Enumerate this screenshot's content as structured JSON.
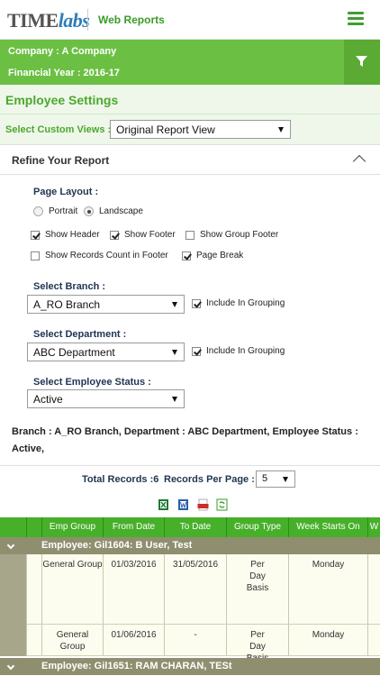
{
  "header": {
    "logo_text_1": "TIME",
    "logo_text_2": "labs",
    "title": "Web Reports",
    "menu_icon": "hamburger-icon"
  },
  "company": {
    "company_line": "Company : A Company",
    "year_line": "Financial Year : 2016-17",
    "filter_icon": "filter-icon"
  },
  "settings": {
    "title": "Employee Settings",
    "custom_views_label": "Select Custom Views :",
    "custom_views_value": "Original Report View"
  },
  "refine": {
    "title": "Refine Your Report",
    "page_layout_label": "Page Layout :",
    "portrait_label": "Portrait",
    "landscape_label": "Landscape",
    "layout_selected": "Landscape",
    "options": [
      {
        "label": "Show Header",
        "checked": true
      },
      {
        "label": "Show Footer",
        "checked": true
      },
      {
        "label": "Show Group Footer",
        "checked": false
      },
      {
        "label": "Show Records Count in Footer",
        "checked": false
      },
      {
        "label": "Page Break",
        "checked": true
      }
    ],
    "branch_label": "Select Branch :",
    "branch_value": "A_RO Branch",
    "branch_grouping_label": "Include In Grouping",
    "branch_grouping": true,
    "department_label": "Select Department :",
    "department_value": "ABC Department",
    "department_grouping_label": "Include In Grouping",
    "department_grouping": true,
    "status_label": "Select Employee Status :",
    "status_value": "Active"
  },
  "summary": "Branch : A_RO Branch, Department : ABC Department, Employee Status : Active,",
  "records": {
    "total_label": "Total Records :6",
    "per_page_label": "Records Per Page :",
    "per_page_value": "5"
  },
  "export_icons": [
    "excel-icon",
    "word-icon",
    "pdf-icon",
    "refresh-icon"
  ],
  "table": {
    "columns": [
      "Emp Group",
      "From Date",
      "To Date",
      "Group Type",
      "Week Starts On",
      "W"
    ],
    "groups": [
      {
        "title": "Employee: Gil1604: B User, Test",
        "rows": [
          [
            "General Group",
            "01/03/2016",
            "31/05/2016",
            "Per Day Basis",
            "Monday"
          ],
          [
            "General Group",
            "01/06/2016",
            "-",
            "Per Day Basis",
            "Monday"
          ]
        ]
      },
      {
        "title": "Employee: Gil1651: RAM CHARAN, TESt",
        "rows": []
      }
    ]
  },
  "colors": {
    "brand_green": "#6bc043",
    "header_green": "#47b02a",
    "group_row": "#8f8f70"
  }
}
